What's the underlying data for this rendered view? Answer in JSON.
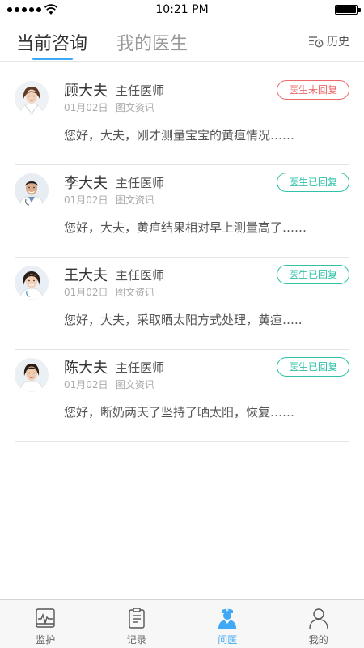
{
  "status_bar": {
    "time": "10:21 PM"
  },
  "tabs": [
    {
      "label": "当前咨询",
      "active": true
    },
    {
      "label": "我的医生",
      "active": false
    }
  ],
  "history_label": "历史",
  "consultations": [
    {
      "doctor": "顾大夫",
      "title": "主任医师",
      "date": "01月02日",
      "type": "图文资讯",
      "status": "医生未回复",
      "status_kind": "pending",
      "message": "您好，大夫，刚才测量宝宝的黄疸情况……",
      "avatar": "female-doctor-avatar"
    },
    {
      "doctor": "李大夫",
      "title": "主任医师",
      "date": "01月02日",
      "type": "图文资讯",
      "status": "医生已回复",
      "status_kind": "replied",
      "message": "您好，大夫，黄疸结果相对早上测量高了……",
      "avatar": "male-doctor-avatar"
    },
    {
      "doctor": "王大夫",
      "title": "主任医师",
      "date": "01月02日",
      "type": "图文资讯",
      "status": "医生已回复",
      "status_kind": "replied",
      "message": "您好，大夫，采取晒太阳方式处理，黄疸…..",
      "avatar": "female-doctor-avatar"
    },
    {
      "doctor": "陈大夫",
      "title": "主任医师",
      "date": "01月02日",
      "type": "图文资讯",
      "status": "医生已回复",
      "status_kind": "replied",
      "message": "您好，断奶两天了坚持了晒太阳，恢复……",
      "avatar": "female-doctor-avatar"
    }
  ],
  "bottom_nav": [
    {
      "label": "监护",
      "icon": "monitor-icon",
      "active": false
    },
    {
      "label": "记录",
      "icon": "clipboard-icon",
      "active": false
    },
    {
      "label": "问医",
      "icon": "doctor-icon",
      "active": true
    },
    {
      "label": "我的",
      "icon": "user-icon",
      "active": false
    }
  ],
  "colors": {
    "accent": "#3fa9f5",
    "pending": "#ee6a6a",
    "replied": "#2fc2a8"
  }
}
